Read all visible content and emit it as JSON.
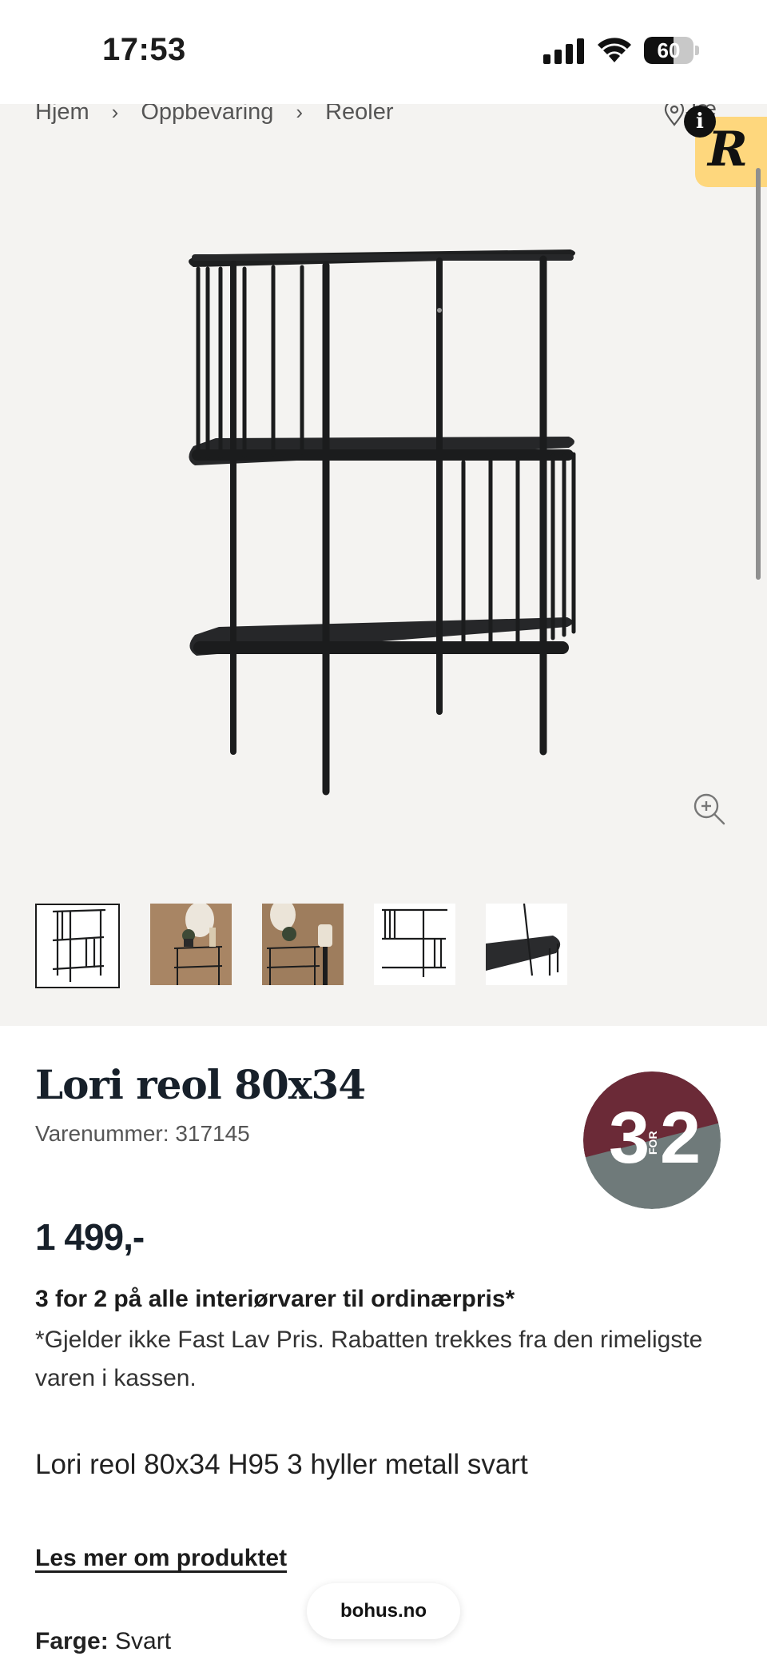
{
  "status_bar": {
    "time": "17:53",
    "battery": "60"
  },
  "breadcrumb": {
    "items": [
      "Hjem",
      "Oppbevaring",
      "Reoler"
    ],
    "store_text": "Jæ"
  },
  "badges": {
    "info_letter": "i",
    "r_letter": "R"
  },
  "gallery": {
    "thumbnails": [
      {
        "name": "thumb-front",
        "active": true
      },
      {
        "name": "thumb-room-1",
        "active": false
      },
      {
        "name": "thumb-room-2",
        "active": false
      },
      {
        "name": "thumb-side",
        "active": false
      },
      {
        "name": "thumb-detail",
        "active": false
      }
    ]
  },
  "product": {
    "title": "Lori reol 80x34",
    "sku": "Varenummer: 317145",
    "price": "1 499,-",
    "promo_title": "3 for 2 på alle interiørvarer til ordinærpris*",
    "promo_note": "*Gjelder ikke Fast Lav Pris. Rabatten trekkes fra den rimeligste varen i kassen.",
    "short_description": "Lori reol 80x34 H95 3 hyller metall svart",
    "read_more": "Les mer om produktet",
    "color_label": "Farge:",
    "color_value": "Svart"
  },
  "promo_badge": {
    "big_left": "3",
    "small": "FOR",
    "big_right": "2",
    "colors": {
      "top": "#6b2a37",
      "bottom": "#6f7a7a"
    }
  },
  "browser": {
    "url": "bohus.no"
  },
  "colors": {
    "gallery_bg": "#f4f3f1",
    "badge_yellow": "#fed77d",
    "text_dark": "#17202a"
  }
}
